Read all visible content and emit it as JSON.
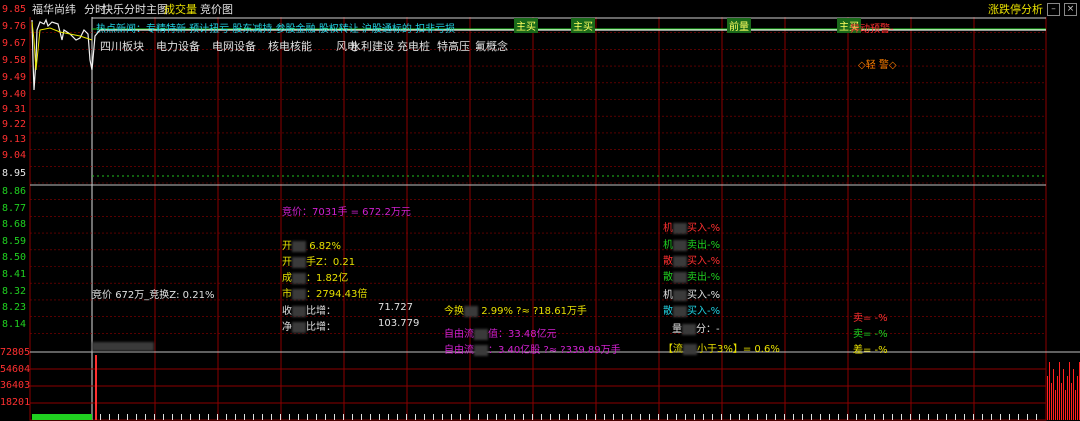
{
  "header": {
    "stock_name": "福华尚纬",
    "tab_time_share": "分时",
    "tab_kuaile": "快乐分时主图",
    "tab_volume": "成交量",
    "tab_auction": "竞价图",
    "right_link": "涨跌停分析",
    "window_buttons": [
      "minimize",
      "restore",
      "close"
    ]
  },
  "y_axis_price": [
    "9.85",
    "9.76",
    "9.67",
    "9.58",
    "9.49",
    "9.40",
    "9.31",
    "9.22",
    "9.13",
    "9.04",
    "8.95",
    "8.86",
    "8.77",
    "8.68",
    "8.59",
    "8.50",
    "8.41",
    "8.32",
    "8.23",
    "8.14"
  ],
  "y_axis_volume": [
    "72805",
    "54604",
    "36403",
    "18201"
  ],
  "news_line": "热点新闻：专精特新 预计扭亏 股东减持 参股金融 股权转让 沪股通标的 扣非亏损",
  "concept_tags": [
    "四川板块",
    "电力设备",
    "电网设备",
    "核电核能",
    "风电",
    "水利建设",
    "充电桩",
    "特高压",
    "氟概念"
  ],
  "markers": {
    "buy1": "主买",
    "buy2": "主买",
    "lead": "前量",
    "buy3": "主买",
    "alert_high": "异动预警-",
    "alert_light": "◇轻 警◇"
  },
  "stats": {
    "auction_price": "竞价：7031手 = 672.2万元",
    "open_pct_label": "开",
    "open_pct_val": "6.82%",
    "open_ratio_label": "开",
    "open_ratio_val": "手Z：0.21",
    "turnover_label": "成",
    "turnover_val": "：1.82亿",
    "market_label": "市",
    "market_val": "：2794.43倍",
    "auction_left": "竞价",
    "auction_left_val": "672万_竞换Z: 0.21%",
    "ratio1_label": "收",
    "ratio1_mid": "比增：",
    "ratio1_val": "71.727",
    "ratio2_label": "净",
    "ratio2_mid": "比增：",
    "ratio2_val": "103.779",
    "today_turn_label": "今换",
    "today_turn_val": "2.99% ?≈ ?18.61万手",
    "free_cap_label": "自由流",
    "free_cap_val": "值：33.48亿元",
    "free_share_label": "自由流",
    "free_share_val": "：3.40亿股 ?≈ ?339.89万手"
  },
  "right_stats": {
    "inst_buy": "买入-%",
    "inst_buy_pre": "机",
    "inst_sell": "卖出-%",
    "inst_sell_pre": "机",
    "big_buy": "买入-%",
    "big_buy_pre": "散",
    "big_sell": "卖出-%",
    "big_sell_pre": "散",
    "inst2_buy": "买入-%",
    "inst2_buy_pre": "机",
    "retail_buy": "买入-%",
    "retail_buy_pre": "散",
    "score": "分：-",
    "score_pre": "量",
    "ratio_small": "小于3%】= 0.6%",
    "ratio_small_pre": "【流",
    "sell_ratio": "卖= -%",
    "buy_ratio": "卖= -%",
    "diff_ratio": "差= -%"
  },
  "colors": {
    "grid_red": "#8b0000",
    "price_red": "#ff3030",
    "volume_green": "#20d020"
  }
}
